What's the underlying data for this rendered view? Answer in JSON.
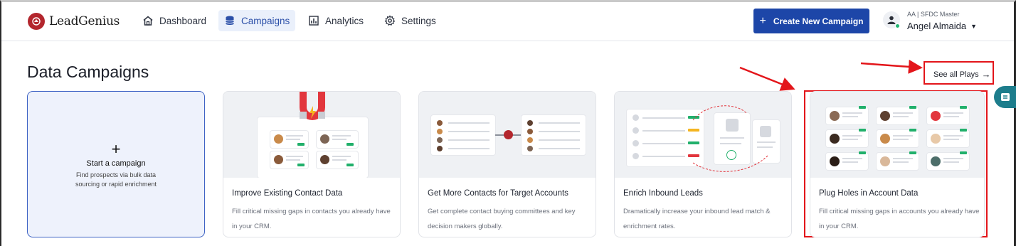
{
  "app": {
    "name": "LeadGenius"
  },
  "nav": [
    {
      "label": "Dashboard",
      "icon": "home-icon",
      "active": false
    },
    {
      "label": "Campaigns",
      "icon": "database-icon",
      "active": true
    },
    {
      "label": "Analytics",
      "icon": "chart-icon",
      "active": false
    },
    {
      "label": "Settings",
      "icon": "gear-icon",
      "active": false
    }
  ],
  "header": {
    "create_button": "Create New Campaign",
    "user_org": "AA | SFDC Master",
    "user_name": "Angel Almaida"
  },
  "page": {
    "title": "Data Campaigns",
    "see_all": "See all Plays"
  },
  "start_card": {
    "plus": "+",
    "title": "Start a campaign",
    "description": "Find prospects via bulk data sourcing or rapid enrichment"
  },
  "cards": [
    {
      "title": "Improve Existing Contact Data",
      "description": "Fill critical missing gaps in contacts you already have in your CRM."
    },
    {
      "title": "Get More Contacts for Target Accounts",
      "description": "Get complete contact buying committees and key decision makers globally."
    },
    {
      "title": "Enrich Inbound Leads",
      "description": "Dramatically increase your inbound lead match & enrichment rates."
    },
    {
      "title": "Plug Holes in Account Data",
      "description": "Fill critical missing gaps in accounts you already have in your CRM."
    }
  ],
  "colors": {
    "brand": "#1d46a8",
    "accent_red": "#e3151a",
    "logo_red": "#b3262d",
    "chat_teal": "#1d7d8c"
  }
}
